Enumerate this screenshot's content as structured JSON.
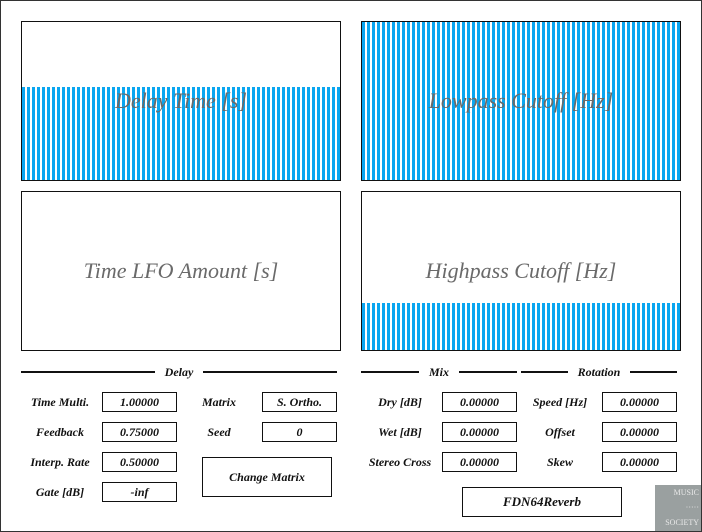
{
  "panels": [
    {
      "title": "Delay Time [s]",
      "level": 0.59
    },
    {
      "title": "Lowpass Cutoff [Hz]",
      "level": 1.0
    },
    {
      "title": "Time LFO Amount [s]",
      "level": 0.0
    },
    {
      "title": "Highpass Cutoff [Hz]",
      "level": 0.3
    }
  ],
  "colors": {
    "fill": "#0aa6f0",
    "title": "#6a6a6a"
  },
  "delay": {
    "heading": "Delay",
    "time_multi": {
      "label": "Time Multi.",
      "value": "1.00000"
    },
    "feedback": {
      "label": "Feedback",
      "value": "0.75000"
    },
    "interp_rate": {
      "label": "Interp. Rate",
      "value": "0.50000"
    },
    "gate": {
      "label": "Gate [dB]",
      "value": "-inf"
    },
    "matrix": {
      "label": "Matrix",
      "value": "S. Ortho."
    },
    "seed": {
      "label": "Seed",
      "value": "0"
    },
    "change_matrix": "Change Matrix"
  },
  "mix": {
    "heading": "Mix",
    "dry": {
      "label": "Dry [dB]",
      "value": "0.00000"
    },
    "wet": {
      "label": "Wet [dB]",
      "value": "0.00000"
    },
    "stereo_cross": {
      "label": "Stereo Cross",
      "value": "0.00000"
    }
  },
  "rotation": {
    "heading": "Rotation",
    "speed": {
      "label": "Speed [Hz]",
      "value": "0.00000"
    },
    "offset": {
      "label": "Offset",
      "value": "0.00000"
    },
    "skew": {
      "label": "Skew",
      "value": "0.00000"
    }
  },
  "plugin_name": "FDN64Reverb",
  "logo": {
    "line1": "MUSIC",
    "line2": "SOCIETY"
  }
}
